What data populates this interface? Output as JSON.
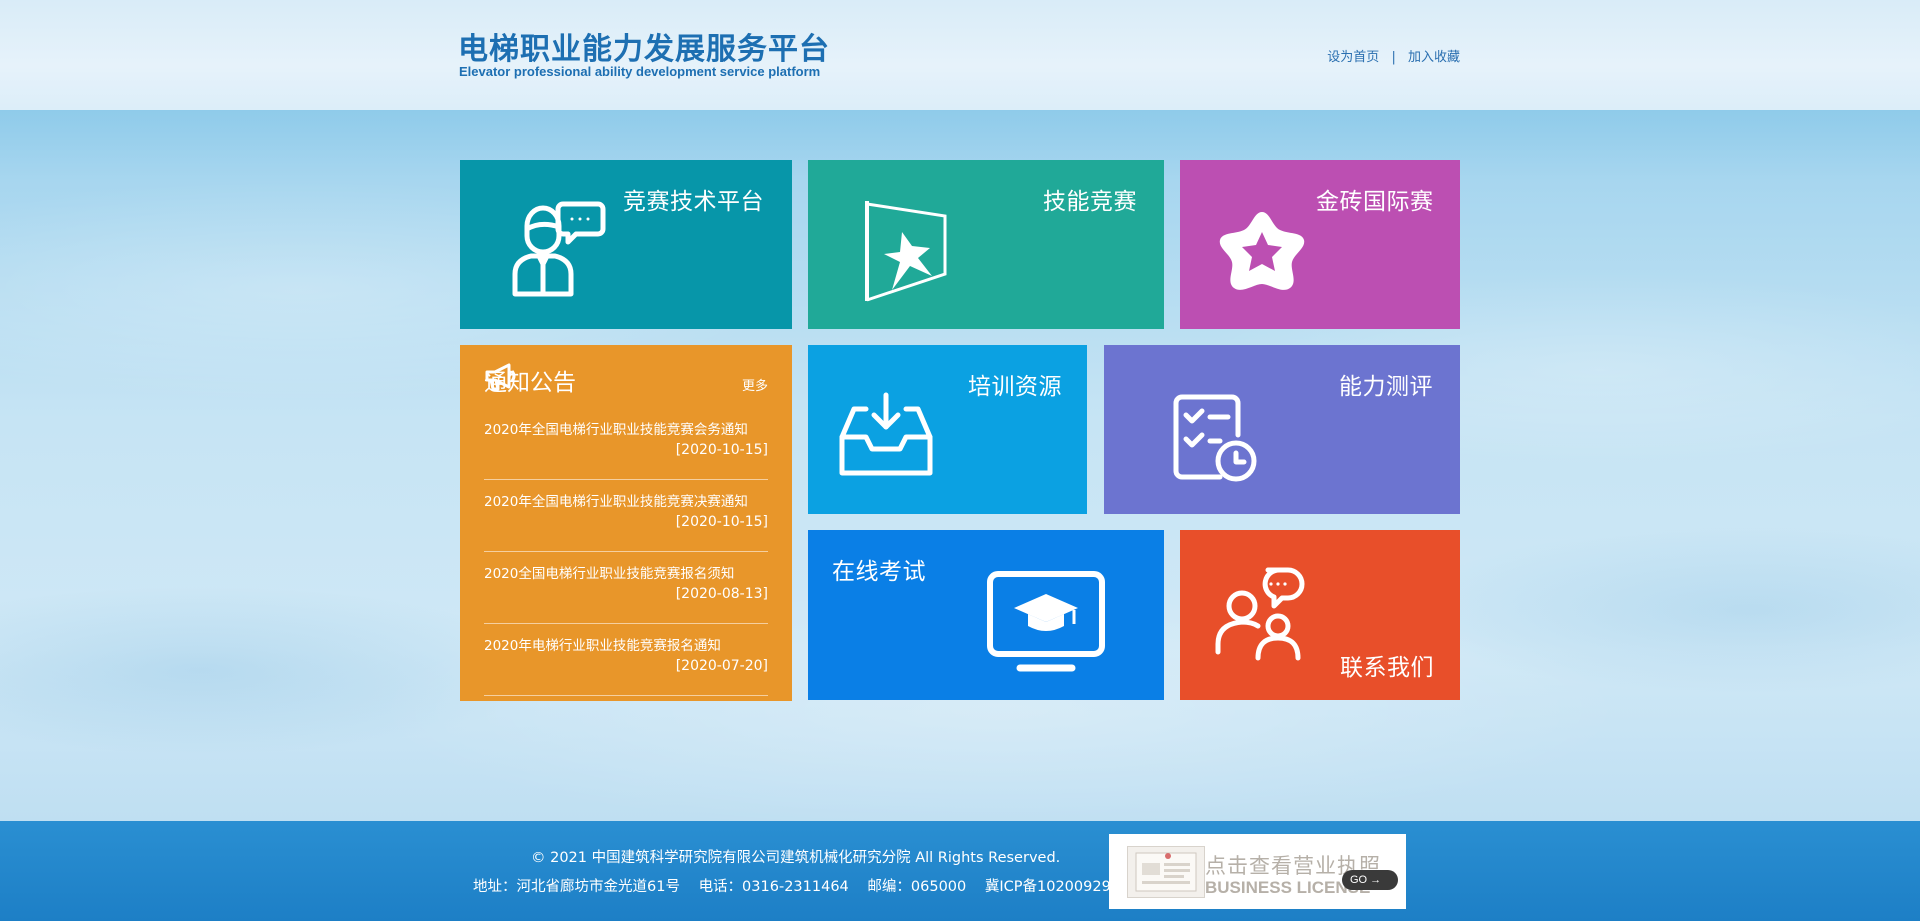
{
  "header": {
    "title": "电梯职业能力发展服务平台",
    "subtitle": "Elevator professional ability development service platform",
    "set_home": "设为首页",
    "separator": "|",
    "add_favorite": "加入收藏"
  },
  "tiles": {
    "tech_platform": {
      "label": "竞赛技术平台",
      "color": "#0796a9",
      "icon": "customer-service-icon"
    },
    "skill_competition": {
      "label": "技能竞赛",
      "color": "#20a998",
      "icon": "flag-icon"
    },
    "golden_brick": {
      "label": "金砖国际赛",
      "color": "#bc4fb2",
      "icon": "star-icon"
    },
    "training": {
      "label": "培训资源",
      "color": "#0ba1e2",
      "icon": "inbox-download-icon"
    },
    "assessment": {
      "label": "能力测评",
      "color": "#6c74d0",
      "icon": "checklist-icon"
    },
    "online_exam": {
      "label": "在线考试",
      "color": "#0a7fe6",
      "icon": "monitor-graduation-icon"
    },
    "contact": {
      "label": "联系我们",
      "color": "#e84f2a",
      "icon": "chat-users-icon"
    }
  },
  "notices": {
    "title": "通知公告",
    "more": "更多",
    "color": "#e8962a",
    "items": [
      {
        "title": "2020年全国电梯行业职业技能竞赛会务通知",
        "date": "[2020-10-15]"
      },
      {
        "title": "2020年全国电梯行业职业技能竞赛决赛通知",
        "date": "[2020-10-15]"
      },
      {
        "title": "2020全国电梯行业职业技能竞赛报名须知",
        "date": "[2020-08-13]"
      },
      {
        "title": "2020年电梯行业职业技能竞赛报名通知",
        "date": "[2020-07-20]"
      }
    ]
  },
  "footer": {
    "copyright": "© 2021 中国建筑科学研究院有限公司建筑机械化研究分院 All Rights Reserved.",
    "address": "地址：河北省廊坊市金光道61号",
    "phone": "电话：0316-2311464",
    "postcode": "邮编：065000",
    "icp": "冀ICP备10200929号-5",
    "license_cn": "点击查看营业执照",
    "license_en": "BUSINESS LICENSE",
    "go": "GO →"
  }
}
